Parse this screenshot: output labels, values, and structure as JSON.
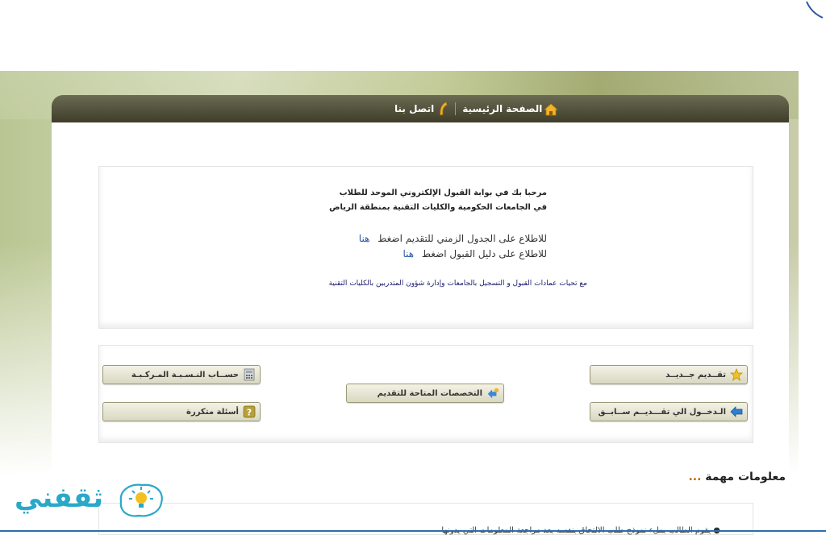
{
  "nav": {
    "home_label": "الصفحة الرئيسية",
    "contact_label": "اتصل بنا"
  },
  "welcome": {
    "line1": "مرحبا بك في بوابة القبول الإلكتروني الموحد للطلاب",
    "line2": "في الجامعات الحكومية والكليات التقنية بمنطقة الرياض",
    "schedule_text": "للاطلاع على الجدول الزمني للتقديم اضغط",
    "guide_text": "للاطلاع على دليل القبول اضغط",
    "here_link": "هنا",
    "greeting": "مع تحيات عمادات القبول و التسجيل بالجامعات وإدارة شؤون المتدربين بالكليات التقنية"
  },
  "actions": {
    "new_apply": "تقــديم جــديــد",
    "prev_apply": "الـدخــول الي تقـــديــم ســابــق",
    "available_majors": "التخصصات المتاحة للتقديم",
    "calc_gpa": "حســاب النـسـبـة المـركـبـة",
    "faq": "أسئلة متكررة"
  },
  "info": {
    "title": "معلومات مهمة",
    "dots": "...",
    "first_item": "يقوم الطالب بملء نموذج طلب الالتحاق بنفسه بعد مراجعة المعلومات التي يدونها"
  },
  "logo": {
    "text": "ثقفني"
  },
  "colors": {
    "nav_bg": "#4a4935",
    "link": "#2a5aa8",
    "accent_orange": "#c06a00",
    "logo": "#2aa8c8"
  }
}
